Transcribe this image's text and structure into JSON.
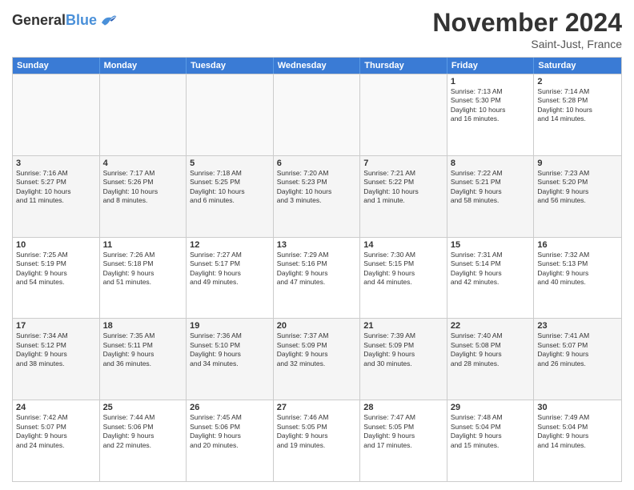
{
  "header": {
    "logo_line1": "General",
    "logo_line2": "Blue",
    "month": "November 2024",
    "location": "Saint-Just, France"
  },
  "days_of_week": [
    "Sunday",
    "Monday",
    "Tuesday",
    "Wednesday",
    "Thursday",
    "Friday",
    "Saturday"
  ],
  "weeks": [
    [
      {
        "day": "",
        "info": ""
      },
      {
        "day": "",
        "info": ""
      },
      {
        "day": "",
        "info": ""
      },
      {
        "day": "",
        "info": ""
      },
      {
        "day": "",
        "info": ""
      },
      {
        "day": "1",
        "info": "Sunrise: 7:13 AM\nSunset: 5:30 PM\nDaylight: 10 hours\nand 16 minutes."
      },
      {
        "day": "2",
        "info": "Sunrise: 7:14 AM\nSunset: 5:28 PM\nDaylight: 10 hours\nand 14 minutes."
      }
    ],
    [
      {
        "day": "3",
        "info": "Sunrise: 7:16 AM\nSunset: 5:27 PM\nDaylight: 10 hours\nand 11 minutes."
      },
      {
        "day": "4",
        "info": "Sunrise: 7:17 AM\nSunset: 5:26 PM\nDaylight: 10 hours\nand 8 minutes."
      },
      {
        "day": "5",
        "info": "Sunrise: 7:18 AM\nSunset: 5:25 PM\nDaylight: 10 hours\nand 6 minutes."
      },
      {
        "day": "6",
        "info": "Sunrise: 7:20 AM\nSunset: 5:23 PM\nDaylight: 10 hours\nand 3 minutes."
      },
      {
        "day": "7",
        "info": "Sunrise: 7:21 AM\nSunset: 5:22 PM\nDaylight: 10 hours\nand 1 minute."
      },
      {
        "day": "8",
        "info": "Sunrise: 7:22 AM\nSunset: 5:21 PM\nDaylight: 9 hours\nand 58 minutes."
      },
      {
        "day": "9",
        "info": "Sunrise: 7:23 AM\nSunset: 5:20 PM\nDaylight: 9 hours\nand 56 minutes."
      }
    ],
    [
      {
        "day": "10",
        "info": "Sunrise: 7:25 AM\nSunset: 5:19 PM\nDaylight: 9 hours\nand 54 minutes."
      },
      {
        "day": "11",
        "info": "Sunrise: 7:26 AM\nSunset: 5:18 PM\nDaylight: 9 hours\nand 51 minutes."
      },
      {
        "day": "12",
        "info": "Sunrise: 7:27 AM\nSunset: 5:17 PM\nDaylight: 9 hours\nand 49 minutes."
      },
      {
        "day": "13",
        "info": "Sunrise: 7:29 AM\nSunset: 5:16 PM\nDaylight: 9 hours\nand 47 minutes."
      },
      {
        "day": "14",
        "info": "Sunrise: 7:30 AM\nSunset: 5:15 PM\nDaylight: 9 hours\nand 44 minutes."
      },
      {
        "day": "15",
        "info": "Sunrise: 7:31 AM\nSunset: 5:14 PM\nDaylight: 9 hours\nand 42 minutes."
      },
      {
        "day": "16",
        "info": "Sunrise: 7:32 AM\nSunset: 5:13 PM\nDaylight: 9 hours\nand 40 minutes."
      }
    ],
    [
      {
        "day": "17",
        "info": "Sunrise: 7:34 AM\nSunset: 5:12 PM\nDaylight: 9 hours\nand 38 minutes."
      },
      {
        "day": "18",
        "info": "Sunrise: 7:35 AM\nSunset: 5:11 PM\nDaylight: 9 hours\nand 36 minutes."
      },
      {
        "day": "19",
        "info": "Sunrise: 7:36 AM\nSunset: 5:10 PM\nDaylight: 9 hours\nand 34 minutes."
      },
      {
        "day": "20",
        "info": "Sunrise: 7:37 AM\nSunset: 5:09 PM\nDaylight: 9 hours\nand 32 minutes."
      },
      {
        "day": "21",
        "info": "Sunrise: 7:39 AM\nSunset: 5:09 PM\nDaylight: 9 hours\nand 30 minutes."
      },
      {
        "day": "22",
        "info": "Sunrise: 7:40 AM\nSunset: 5:08 PM\nDaylight: 9 hours\nand 28 minutes."
      },
      {
        "day": "23",
        "info": "Sunrise: 7:41 AM\nSunset: 5:07 PM\nDaylight: 9 hours\nand 26 minutes."
      }
    ],
    [
      {
        "day": "24",
        "info": "Sunrise: 7:42 AM\nSunset: 5:07 PM\nDaylight: 9 hours\nand 24 minutes."
      },
      {
        "day": "25",
        "info": "Sunrise: 7:44 AM\nSunset: 5:06 PM\nDaylight: 9 hours\nand 22 minutes."
      },
      {
        "day": "26",
        "info": "Sunrise: 7:45 AM\nSunset: 5:06 PM\nDaylight: 9 hours\nand 20 minutes."
      },
      {
        "day": "27",
        "info": "Sunrise: 7:46 AM\nSunset: 5:05 PM\nDaylight: 9 hours\nand 19 minutes."
      },
      {
        "day": "28",
        "info": "Sunrise: 7:47 AM\nSunset: 5:05 PM\nDaylight: 9 hours\nand 17 minutes."
      },
      {
        "day": "29",
        "info": "Sunrise: 7:48 AM\nSunset: 5:04 PM\nDaylight: 9 hours\nand 15 minutes."
      },
      {
        "day": "30",
        "info": "Sunrise: 7:49 AM\nSunset: 5:04 PM\nDaylight: 9 hours\nand 14 minutes."
      }
    ]
  ]
}
